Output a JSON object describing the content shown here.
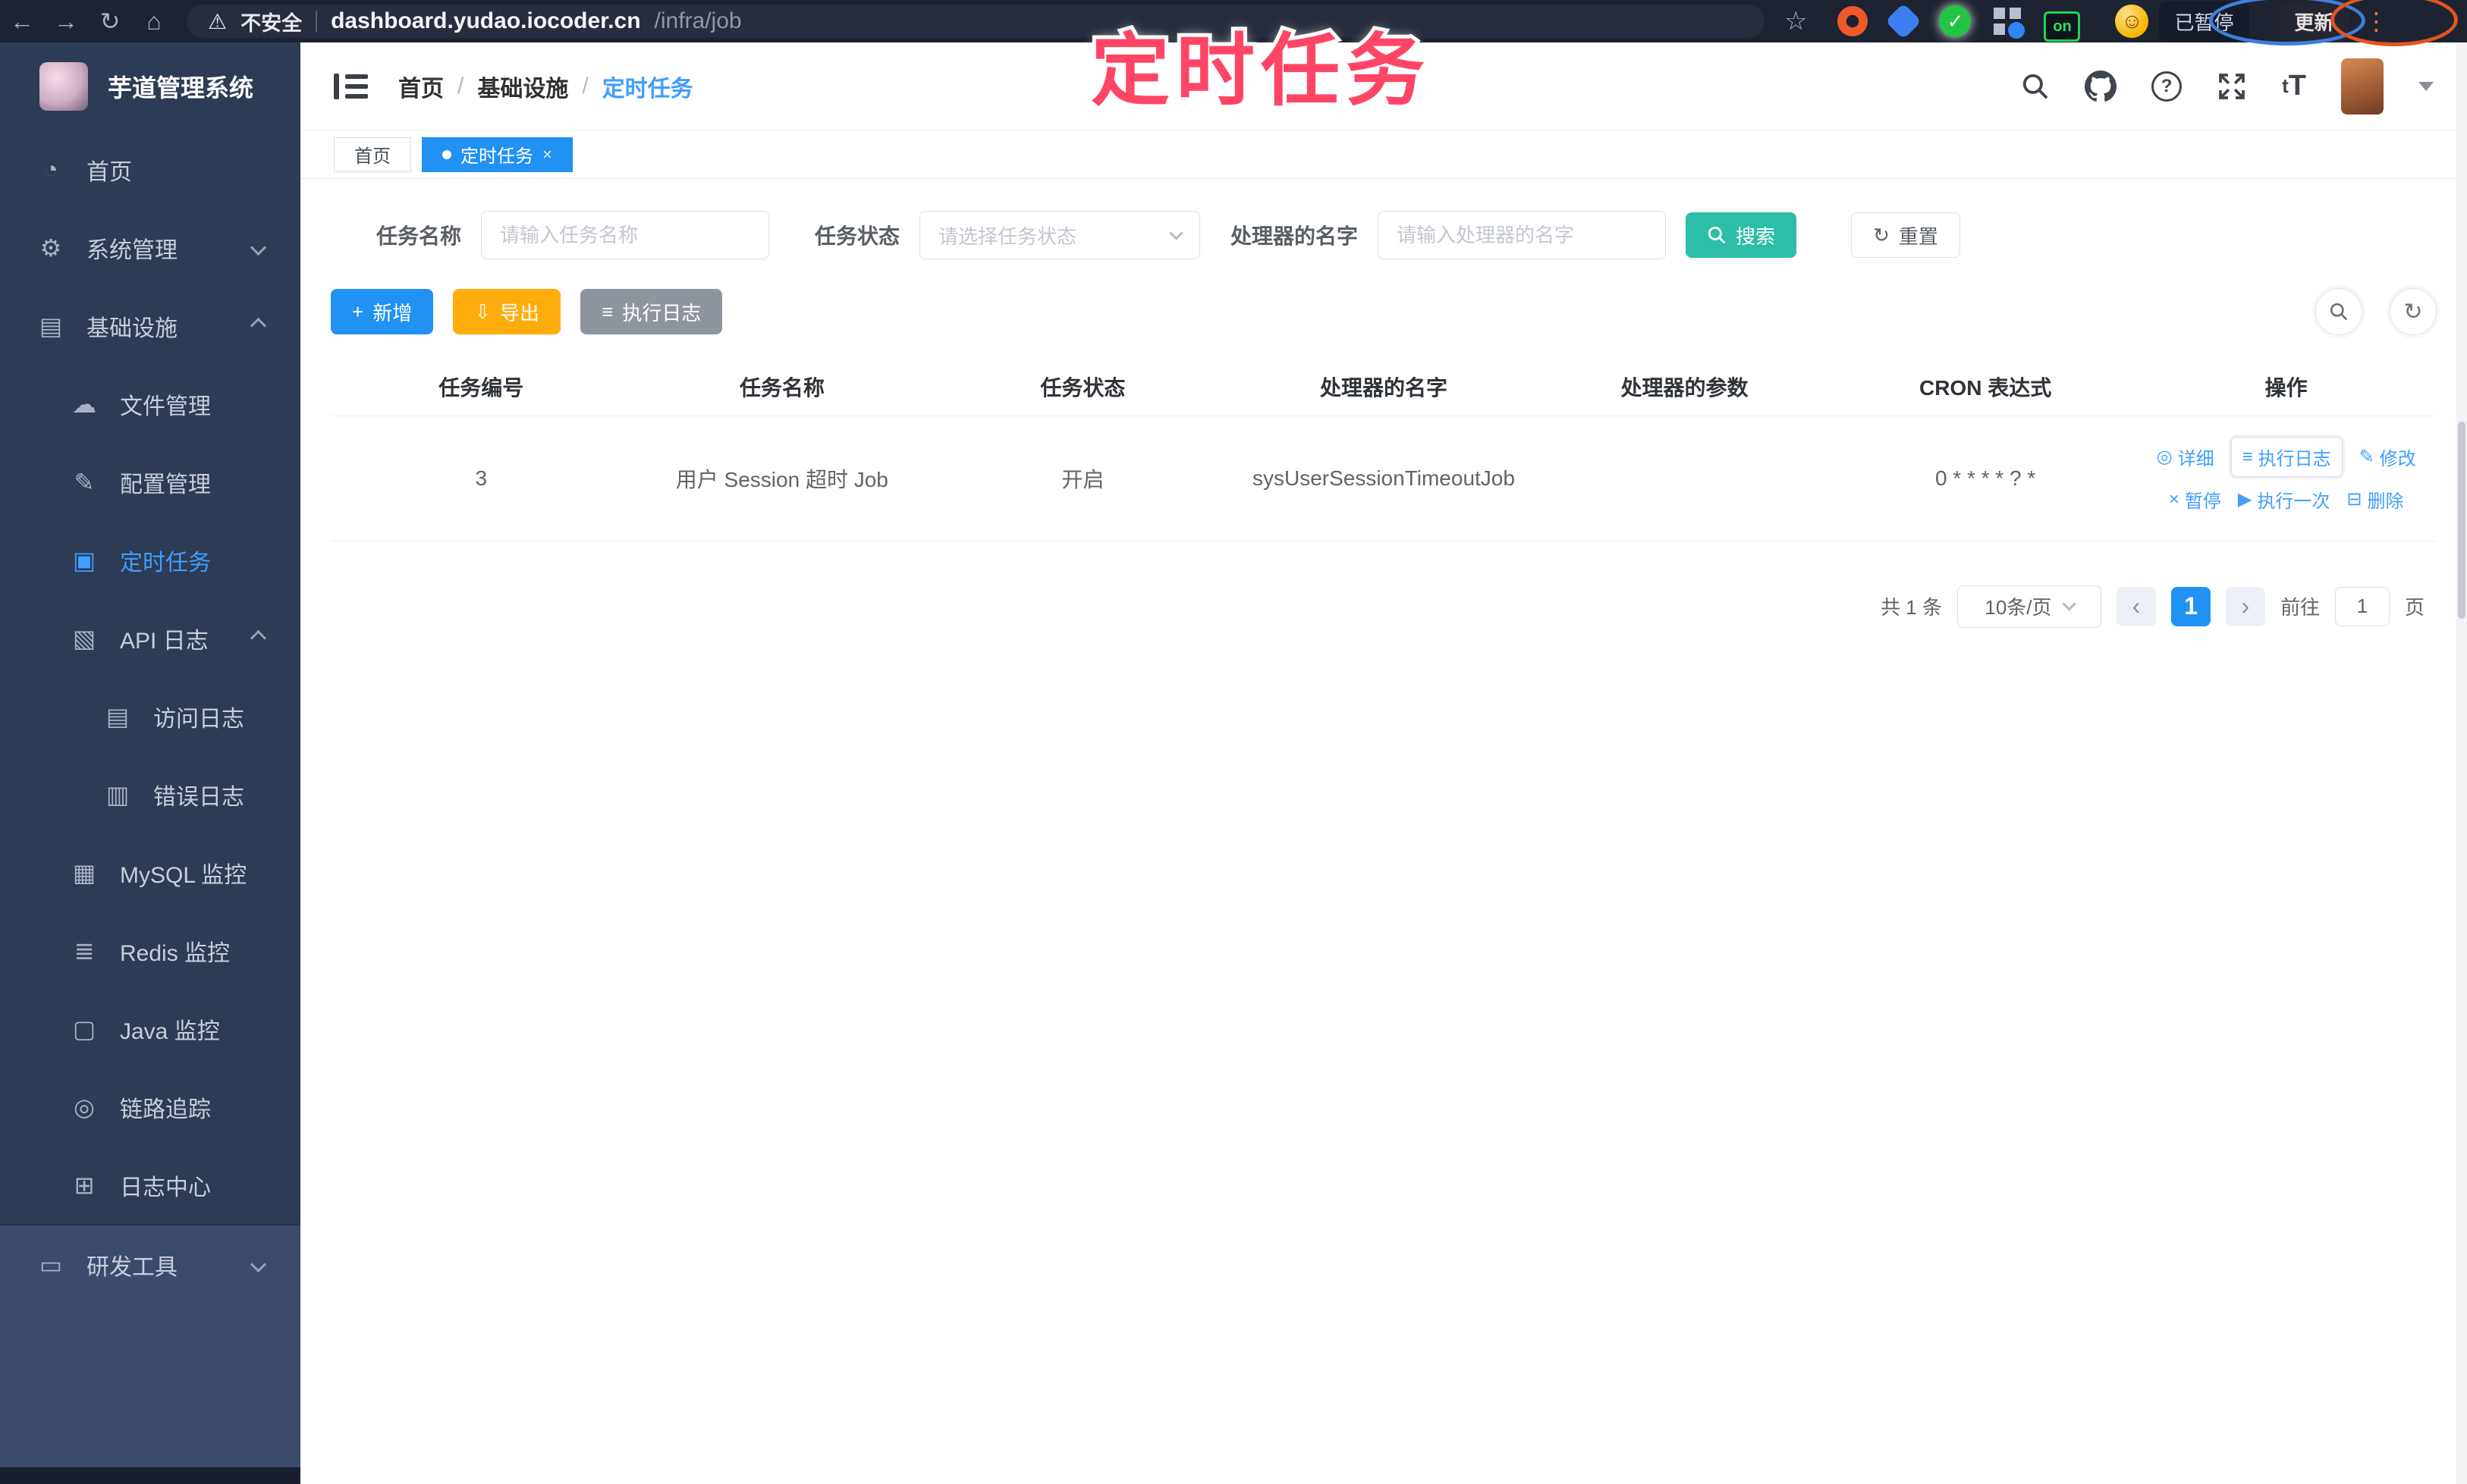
{
  "annotation": {
    "title": "定时任务",
    "color": "#ff4565"
  },
  "browser": {
    "security_label": "不安全",
    "url_host": "dashboard.yudao.iocoder.cn",
    "url_path": "/infra/job",
    "ext_badge": "on",
    "paused_label": "已暂停",
    "update_label": "更新"
  },
  "sidebar": {
    "app_title": "芋道管理系统",
    "items": [
      {
        "label": "首页"
      },
      {
        "label": "系统管理"
      },
      {
        "label": "基础设施"
      },
      {
        "label": "文件管理"
      },
      {
        "label": "配置管理"
      },
      {
        "label": "定时任务"
      },
      {
        "label": "API 日志"
      },
      {
        "label": "访问日志"
      },
      {
        "label": "错误日志"
      },
      {
        "label": "MySQL 监控"
      },
      {
        "label": "Redis 监控"
      },
      {
        "label": "Java 监控"
      },
      {
        "label": "链路追踪"
      },
      {
        "label": "日志中心"
      },
      {
        "label": "研发工具"
      }
    ]
  },
  "header": {
    "breadcrumb": [
      {
        "label": "首页"
      },
      {
        "label": "基础设施"
      },
      {
        "label": "定时任务"
      }
    ],
    "separator": "/"
  },
  "tabs": [
    {
      "label": "首页"
    },
    {
      "label": "定时任务",
      "close": "×"
    }
  ],
  "filters": {
    "job_name_label": "任务名称",
    "job_name_placeholder": "请输入任务名称",
    "job_status_label": "任务状态",
    "job_status_placeholder": "请选择任务状态",
    "handler_label": "处理器的名字",
    "handler_placeholder": "请输入处理器的名字",
    "search_label": "搜索",
    "reset_label": "重置"
  },
  "toolbar": {
    "add_label": "新增",
    "export_label": "导出",
    "exec_log_label": "执行日志"
  },
  "table": {
    "columns": [
      "任务编号",
      "任务名称",
      "任务状态",
      "处理器的名字",
      "处理器的参数",
      "CRON 表达式",
      "操作"
    ],
    "row": {
      "id": "3",
      "name": "用户 Session 超时 Job",
      "status": "开启",
      "handler": "sysUserSessionTimeoutJob",
      "param": "",
      "cron": "0 * * * * ? *"
    },
    "actions": [
      {
        "label": "详细"
      },
      {
        "label": "执行日志"
      },
      {
        "label": "修改"
      },
      {
        "label": "暂停"
      },
      {
        "label": "执行一次"
      },
      {
        "label": "删除"
      }
    ]
  },
  "pagination": {
    "total_label": "共 1 条",
    "page_size": "10条/页",
    "current_page": "1",
    "goto_label": "前往",
    "goto_value": "1",
    "page_label": "页"
  },
  "icons": {
    "back": "←",
    "forward": "→",
    "reload": "↻",
    "home": "⌂",
    "warning": "⚠",
    "star": "☆",
    "check": "✓",
    "kebab": "⋮",
    "smiley": "☺",
    "dashboard": "◔",
    "gear": "⚙",
    "infra": "▤",
    "upload": "☁",
    "config": "✎",
    "job": "▣",
    "apilog": "▧",
    "accesslog": "▤",
    "errorlog": "▥",
    "mysql": "▦",
    "redis": "≣",
    "java": "▢",
    "trace": "◎",
    "logcenter": "⊞",
    "devtool": "▭",
    "plus": "+",
    "download": "⇩",
    "list": "≡",
    "reset": "↻",
    "refresh": "↻",
    "detail": "◎",
    "execlog": "≡",
    "edit": "✎",
    "pause": "×",
    "play": "▶",
    "delete": "⊟",
    "prev": "‹",
    "next": "›"
  },
  "colors": {
    "accent_blue": "#2191f3",
    "link_blue": "#409eff",
    "search_teal": "#2cbea6",
    "export_amber": "#ffad0d",
    "gray_button": "#8e959e",
    "sidebar_bg": "#2e3b54",
    "annotation_pink": "#ff4565"
  }
}
